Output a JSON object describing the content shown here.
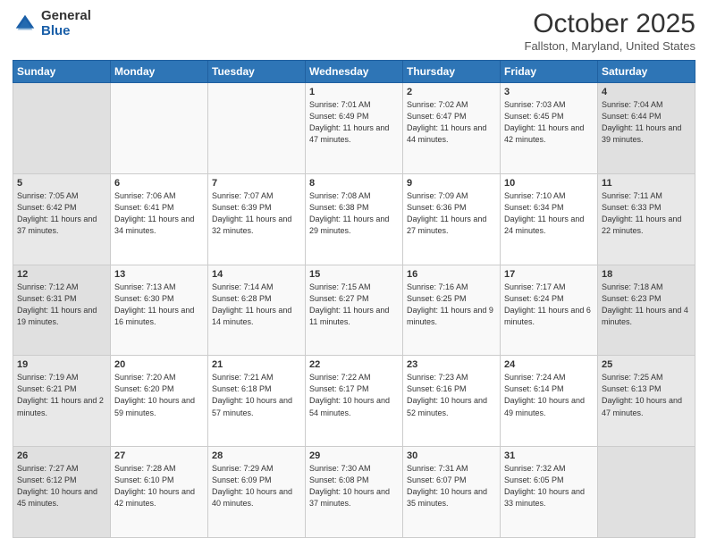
{
  "header": {
    "logo_general": "General",
    "logo_blue": "Blue",
    "month": "October 2025",
    "location": "Fallston, Maryland, United States"
  },
  "days_of_week": [
    "Sunday",
    "Monday",
    "Tuesday",
    "Wednesday",
    "Thursday",
    "Friday",
    "Saturday"
  ],
  "weeks": [
    [
      {
        "num": "",
        "info": ""
      },
      {
        "num": "",
        "info": ""
      },
      {
        "num": "",
        "info": ""
      },
      {
        "num": "1",
        "info": "Sunrise: 7:01 AM\nSunset: 6:49 PM\nDaylight: 11 hours and 47 minutes."
      },
      {
        "num": "2",
        "info": "Sunrise: 7:02 AM\nSunset: 6:47 PM\nDaylight: 11 hours and 44 minutes."
      },
      {
        "num": "3",
        "info": "Sunrise: 7:03 AM\nSunset: 6:45 PM\nDaylight: 11 hours and 42 minutes."
      },
      {
        "num": "4",
        "info": "Sunrise: 7:04 AM\nSunset: 6:44 PM\nDaylight: 11 hours and 39 minutes."
      }
    ],
    [
      {
        "num": "5",
        "info": "Sunrise: 7:05 AM\nSunset: 6:42 PM\nDaylight: 11 hours and 37 minutes."
      },
      {
        "num": "6",
        "info": "Sunrise: 7:06 AM\nSunset: 6:41 PM\nDaylight: 11 hours and 34 minutes."
      },
      {
        "num": "7",
        "info": "Sunrise: 7:07 AM\nSunset: 6:39 PM\nDaylight: 11 hours and 32 minutes."
      },
      {
        "num": "8",
        "info": "Sunrise: 7:08 AM\nSunset: 6:38 PM\nDaylight: 11 hours and 29 minutes."
      },
      {
        "num": "9",
        "info": "Sunrise: 7:09 AM\nSunset: 6:36 PM\nDaylight: 11 hours and 27 minutes."
      },
      {
        "num": "10",
        "info": "Sunrise: 7:10 AM\nSunset: 6:34 PM\nDaylight: 11 hours and 24 minutes."
      },
      {
        "num": "11",
        "info": "Sunrise: 7:11 AM\nSunset: 6:33 PM\nDaylight: 11 hours and 22 minutes."
      }
    ],
    [
      {
        "num": "12",
        "info": "Sunrise: 7:12 AM\nSunset: 6:31 PM\nDaylight: 11 hours and 19 minutes."
      },
      {
        "num": "13",
        "info": "Sunrise: 7:13 AM\nSunset: 6:30 PM\nDaylight: 11 hours and 16 minutes."
      },
      {
        "num": "14",
        "info": "Sunrise: 7:14 AM\nSunset: 6:28 PM\nDaylight: 11 hours and 14 minutes."
      },
      {
        "num": "15",
        "info": "Sunrise: 7:15 AM\nSunset: 6:27 PM\nDaylight: 11 hours and 11 minutes."
      },
      {
        "num": "16",
        "info": "Sunrise: 7:16 AM\nSunset: 6:25 PM\nDaylight: 11 hours and 9 minutes."
      },
      {
        "num": "17",
        "info": "Sunrise: 7:17 AM\nSunset: 6:24 PM\nDaylight: 11 hours and 6 minutes."
      },
      {
        "num": "18",
        "info": "Sunrise: 7:18 AM\nSunset: 6:23 PM\nDaylight: 11 hours and 4 minutes."
      }
    ],
    [
      {
        "num": "19",
        "info": "Sunrise: 7:19 AM\nSunset: 6:21 PM\nDaylight: 11 hours and 2 minutes."
      },
      {
        "num": "20",
        "info": "Sunrise: 7:20 AM\nSunset: 6:20 PM\nDaylight: 10 hours and 59 minutes."
      },
      {
        "num": "21",
        "info": "Sunrise: 7:21 AM\nSunset: 6:18 PM\nDaylight: 10 hours and 57 minutes."
      },
      {
        "num": "22",
        "info": "Sunrise: 7:22 AM\nSunset: 6:17 PM\nDaylight: 10 hours and 54 minutes."
      },
      {
        "num": "23",
        "info": "Sunrise: 7:23 AM\nSunset: 6:16 PM\nDaylight: 10 hours and 52 minutes."
      },
      {
        "num": "24",
        "info": "Sunrise: 7:24 AM\nSunset: 6:14 PM\nDaylight: 10 hours and 49 minutes."
      },
      {
        "num": "25",
        "info": "Sunrise: 7:25 AM\nSunset: 6:13 PM\nDaylight: 10 hours and 47 minutes."
      }
    ],
    [
      {
        "num": "26",
        "info": "Sunrise: 7:27 AM\nSunset: 6:12 PM\nDaylight: 10 hours and 45 minutes."
      },
      {
        "num": "27",
        "info": "Sunrise: 7:28 AM\nSunset: 6:10 PM\nDaylight: 10 hours and 42 minutes."
      },
      {
        "num": "28",
        "info": "Sunrise: 7:29 AM\nSunset: 6:09 PM\nDaylight: 10 hours and 40 minutes."
      },
      {
        "num": "29",
        "info": "Sunrise: 7:30 AM\nSunset: 6:08 PM\nDaylight: 10 hours and 37 minutes."
      },
      {
        "num": "30",
        "info": "Sunrise: 7:31 AM\nSunset: 6:07 PM\nDaylight: 10 hours and 35 minutes."
      },
      {
        "num": "31",
        "info": "Sunrise: 7:32 AM\nSunset: 6:05 PM\nDaylight: 10 hours and 33 minutes."
      },
      {
        "num": "",
        "info": ""
      }
    ]
  ]
}
